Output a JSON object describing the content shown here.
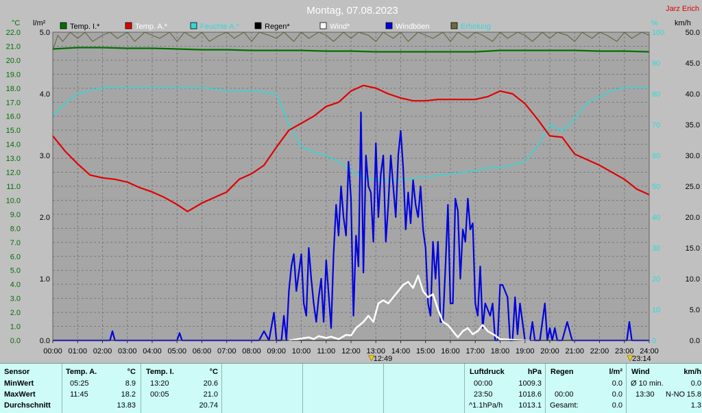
{
  "title": "Montag, 07.08.2023",
  "author": "Jarz Erich",
  "unit_left_temp": "°C",
  "unit_left_rain": "l/m²",
  "unit_right_hum": "%",
  "unit_right_wind": "km/h",
  "legend": [
    {
      "label": "Temp. I.*",
      "color": "#007000"
    },
    {
      "label": "Temp. A.*",
      "color": "#e00000"
    },
    {
      "label": "Feuchte A.*",
      "color": "#30d8d8"
    },
    {
      "label": "Regen*",
      "color": "#000000"
    },
    {
      "label": "Wind*",
      "color": "#ffffff"
    },
    {
      "label": "Windböen",
      "color": "#0000e0"
    },
    {
      "label": "Erholung",
      "color": "#6b6b42"
    }
  ],
  "chart_data": {
    "type": "line",
    "title": "Montag, 07.08.2023",
    "x_ticks": [
      "00:00",
      "01:00",
      "02:00",
      "03:00",
      "04:00",
      "05:00",
      "06:00",
      "07:00",
      "08:00",
      "09:00",
      "10:00",
      "11:00",
      "12:00",
      "13:00",
      "14:00",
      "15:00",
      "16:00",
      "17:00",
      "18:00",
      "19:00",
      "20:00",
      "21:00",
      "22:00",
      "23:00",
      "24:00"
    ],
    "xlim": [
      0,
      24
    ],
    "temp_axis": {
      "label": "°C",
      "ticks": [
        "0.0",
        "1.0",
        "2.0",
        "3.0",
        "4.0",
        "5.0",
        "6.0",
        "7.0",
        "8.0",
        "9.0",
        "10.0",
        "11.0",
        "12.0",
        "13.0",
        "14.0",
        "15.0",
        "16.0",
        "17.0",
        "18.0",
        "19.0",
        "20.0",
        "21.0",
        "22.0"
      ],
      "ylim": [
        0,
        22
      ]
    },
    "rain_axis": {
      "label": "l/m²",
      "ticks": [
        "0.0",
        "1.0",
        "2.0",
        "3.0",
        "4.0",
        "5.0"
      ],
      "ylim": [
        0,
        5
      ]
    },
    "hum_axis": {
      "label": "%",
      "ticks": [
        "0",
        "10",
        "20",
        "30",
        "40",
        "50",
        "60",
        "70",
        "80",
        "90",
        "100"
      ],
      "ylim": [
        0,
        100
      ]
    },
    "wind_axis": {
      "label": "km/h",
      "ticks": [
        "0.0",
        "5.0",
        "10.0",
        "15.0",
        "20.0",
        "25.0",
        "30.0",
        "35.0",
        "40.0",
        "45.0",
        "50.0"
      ],
      "ylim": [
        0,
        50
      ]
    },
    "markers": [
      {
        "x": 12.82,
        "label": "12:49"
      },
      {
        "x": 23.23,
        "label": "23:14"
      }
    ],
    "grid": true,
    "series": [
      {
        "name": "Temp. I.*",
        "axis": "temp",
        "color": "#007000",
        "x": [
          0,
          1,
          2,
          3,
          4,
          5,
          6,
          7,
          8,
          9,
          10,
          11,
          12,
          13,
          14,
          15,
          16,
          17,
          18,
          19,
          20,
          21,
          22,
          23,
          24
        ],
        "values": [
          20.8,
          20.9,
          20.9,
          20.85,
          20.85,
          20.8,
          20.75,
          20.75,
          20.7,
          20.7,
          20.7,
          20.65,
          20.65,
          20.6,
          20.6,
          20.6,
          20.6,
          20.6,
          20.7,
          20.7,
          20.7,
          20.7,
          20.65,
          20.65,
          20.6
        ]
      },
      {
        "name": "Temp. A.*",
        "axis": "temp",
        "color": "#e00000",
        "x": [
          0,
          0.5,
          1,
          1.5,
          2,
          2.5,
          3,
          3.5,
          4,
          4.5,
          5,
          5.42,
          6,
          6.5,
          7,
          7.5,
          8,
          8.5,
          9,
          9.5,
          10,
          10.5,
          11,
          11.5,
          12,
          12.5,
          13,
          13.5,
          14,
          14.5,
          15,
          15.5,
          16,
          16.5,
          17,
          17.5,
          18,
          18.5,
          19,
          19.5,
          20,
          20.5,
          21,
          21.5,
          22,
          22.5,
          23,
          23.5,
          24
        ],
        "values": [
          14.6,
          13.5,
          12.6,
          11.8,
          11.6,
          11.5,
          11.3,
          10.9,
          10.6,
          10.2,
          9.7,
          9.2,
          9.8,
          10.2,
          10.6,
          11.5,
          11.9,
          12.5,
          13.8,
          15,
          15.5,
          16,
          16.7,
          17,
          17.8,
          18.2,
          18.0,
          17.6,
          17.3,
          17.1,
          17.1,
          17.2,
          17.2,
          17.2,
          17.2,
          17.4,
          17.8,
          17.6,
          16.9,
          15.8,
          14.6,
          14.5,
          13.3,
          12.9,
          12.5,
          12.0,
          11.5,
          10.8,
          10.4
        ]
      },
      {
        "name": "Feuchte A.*",
        "axis": "hum",
        "color": "#30d8d8",
        "x": [
          0,
          0.5,
          1,
          1.5,
          2,
          3,
          4,
          5,
          6,
          7,
          8,
          9,
          9.5,
          10,
          10.5,
          11,
          11.5,
          12,
          12.5,
          13,
          13.5,
          14,
          15,
          16,
          17,
          17.5,
          18,
          18.5,
          19,
          19.5,
          20,
          20.5,
          21,
          21.5,
          22,
          22.5,
          23,
          23.5,
          24
        ],
        "values": [
          73,
          77,
          80,
          81,
          82,
          82,
          82,
          82,
          82,
          81,
          81,
          80,
          70,
          63,
          61,
          60,
          58,
          55,
          53,
          52,
          52,
          52,
          53,
          54,
          55,
          56,
          56,
          57,
          58,
          63,
          70,
          68,
          72,
          77,
          79,
          81,
          82,
          82,
          82
        ]
      },
      {
        "name": "Erholung",
        "axis": "hum",
        "color": "#6b6b42",
        "x": [
          0,
          0.2,
          0.4,
          0.7,
          1,
          1.3,
          1.6,
          2,
          2.3,
          2.6,
          3,
          3.3,
          3.7,
          4,
          4.3,
          4.7,
          5,
          5.3,
          5.7,
          6,
          6.3,
          6.7,
          7,
          7.3,
          7.7,
          8,
          8.3,
          8.7,
          9,
          9.3,
          9.7,
          10,
          10.3,
          10.7,
          11,
          11.3,
          11.7,
          12,
          12.3,
          12.7,
          13,
          13.3,
          13.7,
          14,
          14.3,
          14.7,
          15,
          15.3,
          15.7,
          16,
          16.3,
          16.7,
          17,
          17.3,
          17.7,
          18,
          18.3,
          18.7,
          19,
          19.3,
          19.7,
          20,
          20.3,
          20.7,
          21,
          21.3,
          21.7,
          22,
          22.3,
          22.7,
          23,
          23.3,
          23.7,
          24
        ],
        "values": [
          94,
          99,
          97,
          100,
          98,
          100,
          97,
          99,
          100,
          98,
          100,
          97,
          100,
          99,
          98,
          100,
          97,
          100,
          98,
          100,
          97,
          99,
          100,
          98,
          100,
          97,
          100,
          99,
          98,
          100,
          97,
          100,
          98,
          100,
          99,
          97,
          100,
          98,
          100,
          99,
          97,
          100,
          98,
          100,
          97,
          100,
          99,
          98,
          100,
          97,
          100,
          98,
          100,
          99,
          97,
          100,
          98,
          100,
          99,
          97,
          100,
          98,
          100,
          99,
          97,
          100,
          98,
          100,
          99,
          97,
          100,
          98,
          100,
          99
        ]
      },
      {
        "name": "Windböen",
        "axis": "wind",
        "color": "#0000e0",
        "x": [
          0,
          2.3,
          2.4,
          2.5,
          5.0,
          5.1,
          5.2,
          8.3,
          8.5,
          8.7,
          8.9,
          9.0,
          9.2,
          9.3,
          9.4,
          9.5,
          9.6,
          9.7,
          9.8,
          9.9,
          10.0,
          10.1,
          10.2,
          10.3,
          10.4,
          10.5,
          10.6,
          10.7,
          10.8,
          10.9,
          11.0,
          11.2,
          11.3,
          11.4,
          11.5,
          11.6,
          11.7,
          11.8,
          11.9,
          12.0,
          12.1,
          12.2,
          12.3,
          12.4,
          12.5,
          12.6,
          12.7,
          12.8,
          12.9,
          13.0,
          13.1,
          13.2,
          13.3,
          13.4,
          13.5,
          13.6,
          13.7,
          13.8,
          13.9,
          14.0,
          14.1,
          14.2,
          14.3,
          14.4,
          14.5,
          14.6,
          14.7,
          14.8,
          14.9,
          15.0,
          15.1,
          15.2,
          15.3,
          15.4,
          15.5,
          15.6,
          15.7,
          15.8,
          15.9,
          16.0,
          16.1,
          16.2,
          16.3,
          16.4,
          16.5,
          16.6,
          16.7,
          16.8,
          16.9,
          17.0,
          17.1,
          17.2,
          17.3,
          17.4,
          17.5,
          17.6,
          17.7,
          17.8,
          17.9,
          18.0,
          18.1,
          18.2,
          18.3,
          18.4,
          18.5,
          18.6,
          18.7,
          18.8,
          19.0,
          19.1,
          19.2,
          19.3,
          19.4,
          19.6,
          19.8,
          19.9,
          20.0,
          20.1,
          20.2,
          20.3,
          20.4,
          20.5,
          20.7,
          20.9,
          23.0,
          23.1,
          23.2,
          23.3,
          24
        ],
        "values": [
          0,
          0,
          1.5,
          0,
          0,
          1.2,
          0,
          0,
          1.5,
          0,
          4.5,
          0,
          0,
          4,
          0,
          8,
          12,
          14,
          8,
          11,
          14,
          6,
          4,
          15,
          10,
          6,
          3,
          7,
          10,
          3,
          13,
          2,
          14,
          22,
          17,
          25,
          20,
          17,
          29,
          23,
          4,
          17,
          12,
          37,
          11,
          30,
          25,
          24,
          16,
          32,
          20,
          27,
          30,
          16,
          22,
          30,
          25,
          20,
          30,
          34,
          28,
          18,
          24,
          19,
          26,
          22,
          20,
          25,
          18,
          15,
          6,
          4,
          16,
          10,
          16,
          3,
          3,
          12,
          22,
          6,
          6,
          23,
          21,
          10,
          18,
          16,
          23,
          18,
          19,
          6,
          4,
          12,
          2,
          6,
          5,
          4,
          6,
          0,
          0,
          9,
          9,
          8,
          7,
          0,
          0,
          7,
          1,
          6,
          0,
          0,
          0,
          3,
          0,
          0,
          6,
          0,
          2,
          0,
          2,
          0,
          0,
          0,
          3,
          0,
          0,
          0,
          3,
          0,
          0
        ]
      },
      {
        "name": "Wind*",
        "axis": "wind",
        "color": "#ffffff",
        "x": [
          9.5,
          10.0,
          10.3,
          10.5,
          10.7,
          11.0,
          11.2,
          11.5,
          11.8,
          12.0,
          12.2,
          12.5,
          12.7,
          12.9,
          13.1,
          13.3,
          13.5,
          13.7,
          13.9,
          14.1,
          14.3,
          14.5,
          14.7,
          14.9,
          15.1,
          15.3,
          15.5,
          15.7,
          15.9,
          16.1,
          16.3,
          16.5,
          16.7,
          16.9,
          17.1,
          17.3,
          17.5,
          17.8,
          18.0,
          18.5,
          19.0,
          19.2
        ],
        "values": [
          0,
          0.3,
          0.5,
          0.2,
          0.7,
          0.4,
          0.6,
          0.2,
          0.9,
          0.8,
          2,
          3,
          4,
          3,
          6,
          6.5,
          6,
          7,
          8,
          9,
          9.5,
          8.5,
          10.5,
          8,
          7,
          7.5,
          5,
          3,
          2.5,
          1.5,
          0.5,
          1.5,
          2,
          1,
          1.5,
          2.5,
          1.5,
          0.8,
          0.2,
          0.1,
          0,
          0
        ]
      },
      {
        "name": "Regen*",
        "axis": "rain",
        "color": "#000000",
        "x": [
          0,
          24
        ],
        "values": [
          0,
          0
        ]
      }
    ]
  },
  "panel": {
    "sensor": {
      "header": "Sensor",
      "rows": [
        "MinWert",
        "MaxWert",
        "Durchschnitt"
      ]
    },
    "temp_a": {
      "header": "Temp. A.",
      "unit": "°C",
      "min_time": "05:25",
      "min_val": "8.9",
      "max_time": "11:45",
      "max_val": "18.2",
      "avg_val": "13.83"
    },
    "temp_i": {
      "header": "Temp. I.",
      "unit": "°C",
      "min_time": "13:20",
      "min_val": "20.6",
      "max_time": "00:05",
      "max_val": "21.0",
      "avg_val": "20.74"
    },
    "luftdruck": {
      "header": "Luftdruck",
      "unit": "hPa",
      "r1_left": "00:00",
      "r1_val": "1009.3",
      "r2_left": "23:50",
      "r2_val": "1018.6",
      "r3_left": "^1.1hPa/h",
      "r3_val": "1013.1"
    },
    "regen": {
      "header": "Regen",
      "unit": "l/m²",
      "r2_left": "00:00",
      "r2_val": "0.0",
      "r3_left": "Gesamt:",
      "r3_val": "0.0",
      "r1_val": "0.0"
    },
    "wind": {
      "header": "Wind",
      "unit": "km/h",
      "r1_left": "Ø 10 min.",
      "r1_val": "0.0",
      "r2_left": "13:30",
      "r2_mid": "N-NO",
      "r2_val": "15.8",
      "r3_val": "1.3"
    }
  }
}
